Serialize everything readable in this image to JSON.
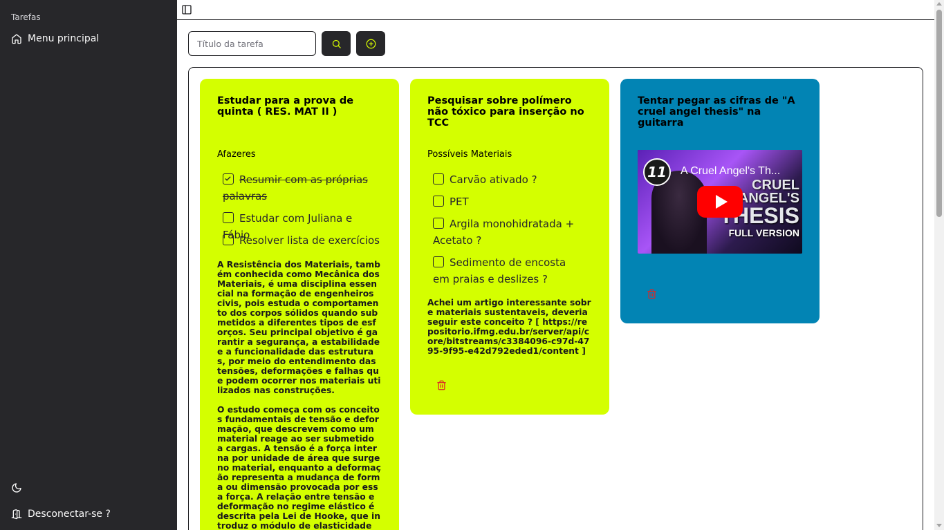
{
  "sidebar": {
    "group_label": "Tarefas",
    "menu_label": "Menu principal",
    "logout_label": "Desconectar-se ?"
  },
  "search": {
    "placeholder": "Título da tarefa"
  },
  "colors": {
    "sidebar_bg": "#27272a",
    "accent": "#d4ff00",
    "card_blue": "#0284b4",
    "trash": "#dc2626"
  },
  "cards": [
    {
      "title": "Estudar para a prova de quinta ( RES. MAT II )",
      "section": "Afazeres",
      "todos": [
        {
          "label": "Resumir com as próprias palavras",
          "checked": true
        },
        {
          "label": "Estudar com Juliana e Fábio",
          "checked": false
        },
        {
          "label": "Resolver lista de exercícios",
          "checked": false
        }
      ],
      "description": "A Resistência dos Materiais, também conhecida como Mecânica dos Materiais, é uma disciplina essencial na formação de engenheiros civis, pois estuda o comportamento dos corpos sólidos quando submetidos a diferentes tipos de esforços. Seu principal objetivo é garantir a segurança, a estabilidade e a funcionalidade das estruturas, por meio do entendimento das tensões, deformações e falhas que podem ocorrer nos materiais utilizados nas construções.\n\nO estudo começa com os conceitos fundamentais de tensão e deformação, que descrevem como um material reage ao ser submetido a cargas. A tensão é a força interna por unidade de área que surge no material, enquanto a deformação representa a mudança de forma ou dimensão provocada por essa força. A relação entre tensão e deformação no regime elástico é descrita pela Lei de Hooke, que introduz o módulo de elasticidade (E), parâmetro essencial na escolha de materiais."
    },
    {
      "title": "Pesquisar sobre polímero não tóxico para inserção no TCC",
      "section": "Possíveis Materiais",
      "todos": [
        {
          "label": "Carvão ativado ?",
          "checked": false
        },
        {
          "label": "PET",
          "checked": false
        },
        {
          "label": "Argila monohidratada + Acetato ?",
          "checked": false
        },
        {
          "label": "Sedimento de encosta em praias e deslizes ?",
          "checked": false
        }
      ],
      "description": "Achei um artigo interessante sobre materiais sustentaveis, deveria seguir este conceito ? [ https://repositorio.ifmg.edu.br/server/api/core/bitstreams/c3384096-c97d-4795-9f95-e42d792eded1/content ]"
    },
    {
      "title": "Tentar pegar as cifras de \"A cruel angel thesis\" na guitarra",
      "video": {
        "title": "A Cruel Angel's Th...",
        "thumb_line1": "CRUEL",
        "thumb_line2": "ANGEL'S",
        "thumb_line3": "THESIS",
        "thumb_line4": "FULL VERSION"
      }
    }
  ]
}
